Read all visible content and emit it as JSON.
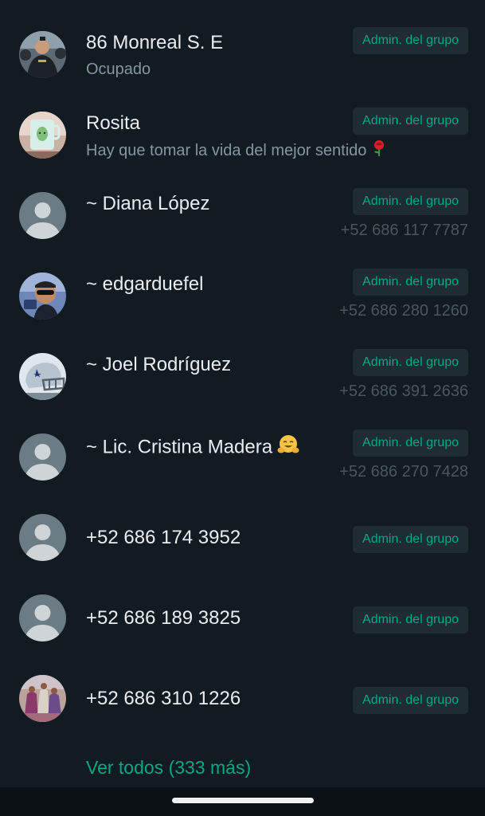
{
  "participants": [
    {
      "name": "86 Monreal S. E",
      "about": "Ocupado",
      "phone": "",
      "badge": "Admin. del grupo",
      "avatar": "photo-officers"
    },
    {
      "name": "Rosita",
      "about": "Hay que tomar la vida del mejor sentido",
      "about_emoji": "rose-emoji",
      "phone": "",
      "badge": "Admin. del grupo",
      "avatar": "photo-cactus-mug"
    },
    {
      "name": "~ Diana López",
      "about": "",
      "phone": "+52 686 117 7787",
      "badge": "Admin. del grupo",
      "avatar": "default-avatar"
    },
    {
      "name": "~ edgarduefel",
      "about": "",
      "phone": "+52 686 280 1260",
      "badge": "Admin. del grupo",
      "avatar": "photo-man-sunglasses"
    },
    {
      "name": "~ Joel Rodríguez",
      "about": "",
      "phone": "+52 686 391 2636",
      "badge": "Admin. del grupo",
      "avatar": "photo-football-helmet"
    },
    {
      "name": "~ Lic. Cristina Madera",
      "name_emoji": "hugging-face-emoji",
      "about": "",
      "phone": "+52 686 270 7428",
      "badge": "Admin. del grupo",
      "avatar": "default-avatar"
    },
    {
      "name": "+52 686 174 3952",
      "about": "",
      "phone": "",
      "badge": "Admin. del grupo",
      "avatar": "default-avatar"
    },
    {
      "name": "+52 686 189 3825",
      "about": "",
      "phone": "",
      "badge": "Admin. del grupo",
      "avatar": "default-avatar"
    },
    {
      "name": "+52 686 310 1226",
      "about": "",
      "phone": "",
      "badge": "Admin. del grupo",
      "avatar": "photo-dancers"
    }
  ],
  "see_all": "Ver todos (333 más)",
  "colors": {
    "background": "#121b22",
    "accent": "#00a884",
    "badge_bg": "#1f2c33",
    "secondary_text": "#8696a0"
  }
}
